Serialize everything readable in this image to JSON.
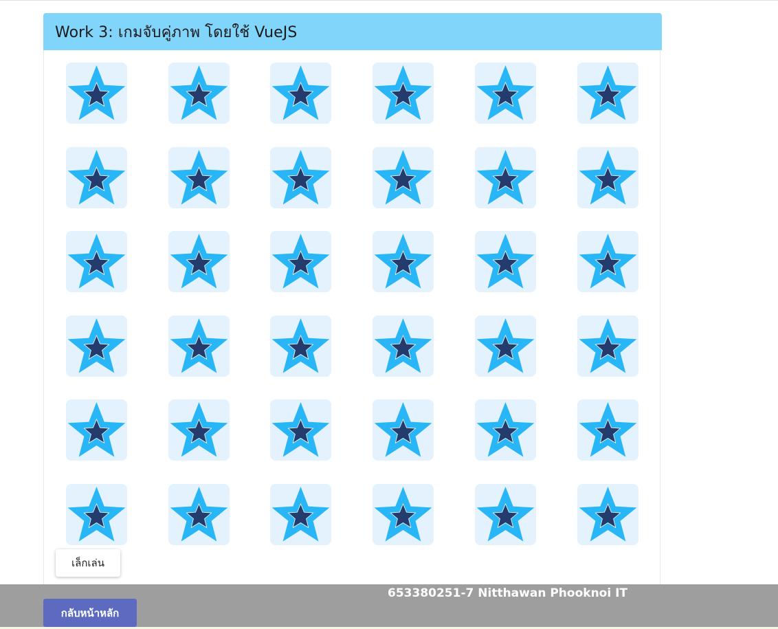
{
  "header": {
    "title": "Work 3: เกมจับคู่ภาพ โดยใช้ VueJS"
  },
  "board": {
    "rows": 6,
    "columns": 6,
    "card_icon": "star-icon",
    "colors": {
      "tile_background": "#e3f2fd",
      "star_outer": "#29b6f6",
      "star_inner": "#243b6e"
    }
  },
  "controls": {
    "play_label": "เล็กเล่น"
  },
  "footer": {
    "credit": "653380251-7 Nitthawan Phooknoi IT",
    "home_label": "กลับหน้าหลัก",
    "colors": {
      "background": "#9e9e9e",
      "home_button": "#5c6bc0"
    }
  }
}
